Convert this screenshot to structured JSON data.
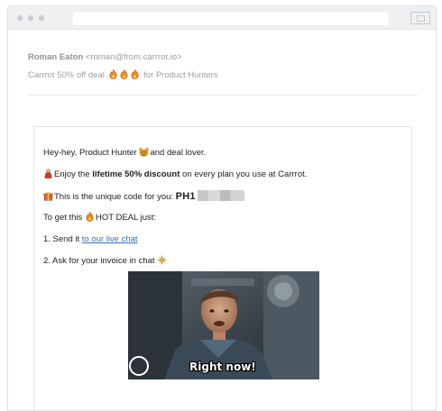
{
  "browser": {
    "window_dots": [
      "close-dot",
      "minimize-dot",
      "maximize-dot"
    ]
  },
  "email": {
    "from_name": "Roman Eaton",
    "from_address": "<roman@from.carrrot.io>",
    "subject_before": "Carrrot 50% off deal",
    "subject_after": " for Product Hunters",
    "subject_icons": [
      "fire-icon",
      "fire-icon",
      "fire-icon"
    ]
  },
  "body": {
    "greeting": "Hey-hey, Product Hunter ",
    "greeting_tail": "and deal lover.",
    "discount_prefix": "Enjoy the ",
    "discount_bold": "lifetime 50% discount",
    "discount_suffix": " on every plan you use at Carrrot.",
    "code_prefix": "This is the unique code for you: ",
    "code_value": "PH1",
    "deal_prefix": "To get this ",
    "deal_suffix": "HOT DEAL just:",
    "step1_prefix": "1. Send it ",
    "step1_link": "to our live chat",
    "step2": "2. Ask for your invoice in chat ",
    "gif_caption": "Right now!"
  },
  "colors": {
    "link": "#3b6fb6",
    "fire": "#f28c1f",
    "gift": "#e8632b",
    "titlebar": "#eef0f2"
  }
}
